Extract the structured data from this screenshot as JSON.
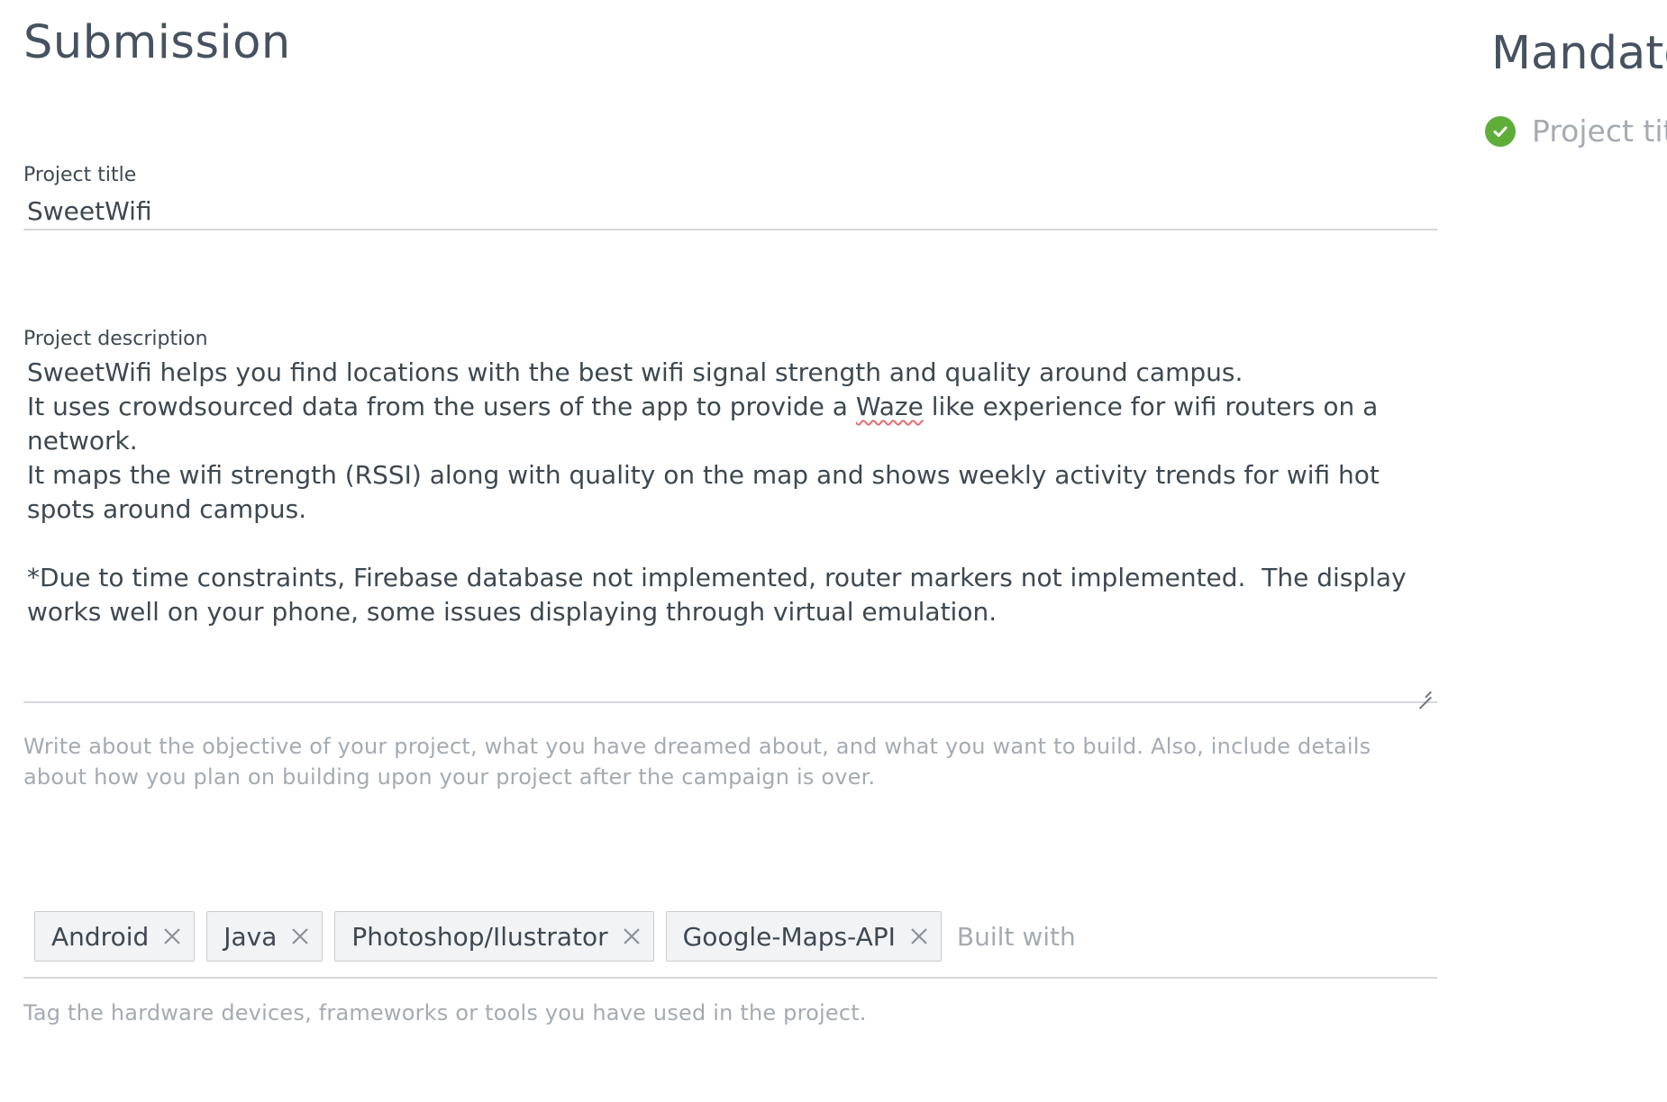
{
  "page": {
    "title": "Submission"
  },
  "project_title": {
    "label": "Project title",
    "value": "SweetWifi"
  },
  "project_description": {
    "label": "Project description",
    "line1": "SweetWifi helps you find locations with the best wifi signal strength and quality around campus.",
    "line2_before": "It uses crowdsourced data from the users of the app to provide a ",
    "line2_misspelled": "Waze",
    "line2_after": " like experience for wifi routers on a network.",
    "line3": "It maps the wifi strength (RSSI) along with quality on the map and shows weekly activity trends for wifi hot spots around campus.",
    "line4": "*Due to time constraints, Firebase database not implemented, router markers not implemented.  The display works well on your phone, some issues displaying through virtual emulation.",
    "hint": "Write about the objective of your project, what you have dreamed about, and what you want to build. Also, include details about how you plan on building upon your project after the campaign is over."
  },
  "built_with": {
    "tags": [
      "Android",
      "Java",
      "Photoshop/Ilustrator",
      "Google-Maps-API"
    ],
    "placeholder": "Built with",
    "hint": "Tag the hardware devices, frameworks or tools you have used in the project."
  },
  "sidebar": {
    "title": "Mandatory",
    "items": [
      {
        "label": "Project title",
        "status": "complete",
        "status_color": "#5fae3a"
      }
    ]
  },
  "colors": {
    "text": "#3d4852",
    "muted": "#a5abb2",
    "border": "#d4d7db",
    "tag_bg": "#f2f3f4",
    "check_green": "#5fae3a",
    "spellcheck": "#e86b6b"
  }
}
